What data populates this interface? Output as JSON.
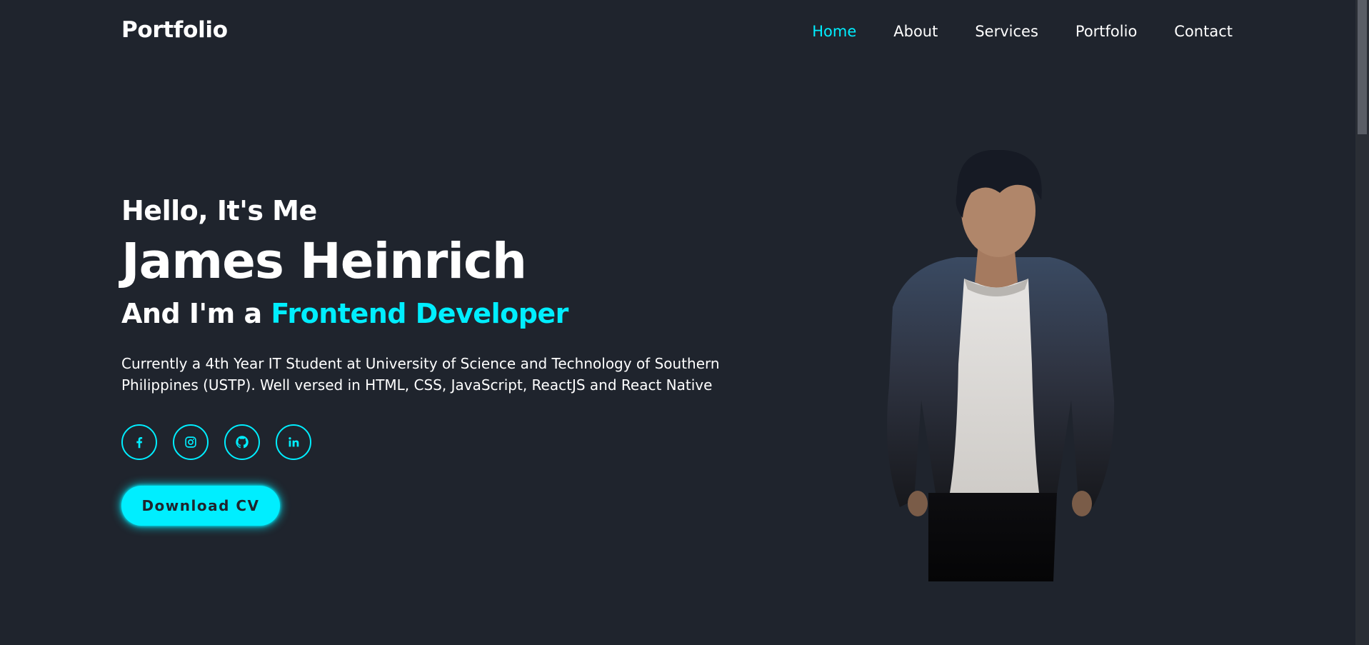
{
  "header": {
    "logo": "Portfolio",
    "nav": [
      {
        "label": "Home",
        "active": true
      },
      {
        "label": "About",
        "active": false
      },
      {
        "label": "Services",
        "active": false
      },
      {
        "label": "Portfolio",
        "active": false
      },
      {
        "label": "Contact",
        "active": false
      }
    ]
  },
  "hero": {
    "greeting": "Hello, It's Me",
    "name": "James Heinrich",
    "role_prefix": "And I'm a",
    "role_highlight": "Frontend Developer",
    "bio": "Currently a 4th Year IT Student at University of Science and Technology of Southern Philippines (USTP). Well versed in HTML, CSS, JavaScript, ReactJS and React Native",
    "socials": [
      {
        "icon": "facebook-icon"
      },
      {
        "icon": "instagram-icon"
      },
      {
        "icon": "github-icon"
      },
      {
        "icon": "linkedin-icon"
      }
    ],
    "cv_button": "Download CV"
  },
  "colors": {
    "background": "#1f242d",
    "accent": "#00eeff",
    "text": "#ffffff"
  }
}
